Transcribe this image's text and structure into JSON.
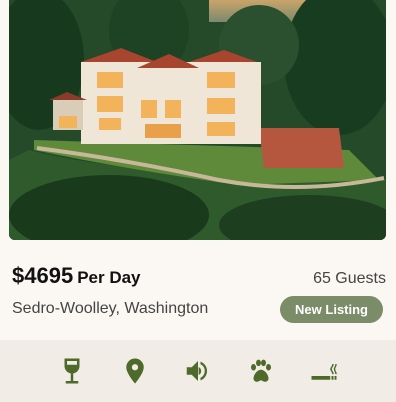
{
  "listing": {
    "price": "$4695",
    "price_unit": "Per Day",
    "guests": "65 Guests",
    "location": "Sedro-Woolley, Washington",
    "badge": "New Listing"
  },
  "amenities": [
    {
      "icon": "wine-glass-icon"
    },
    {
      "icon": "location-pin-icon"
    },
    {
      "icon": "speaker-icon"
    },
    {
      "icon": "paw-icon"
    },
    {
      "icon": "smoking-icon"
    }
  ],
  "colors": {
    "accent": "#4d6a2a",
    "badge_bg": "#7a8c68",
    "amenity_bar_bg": "#f1ece6"
  }
}
